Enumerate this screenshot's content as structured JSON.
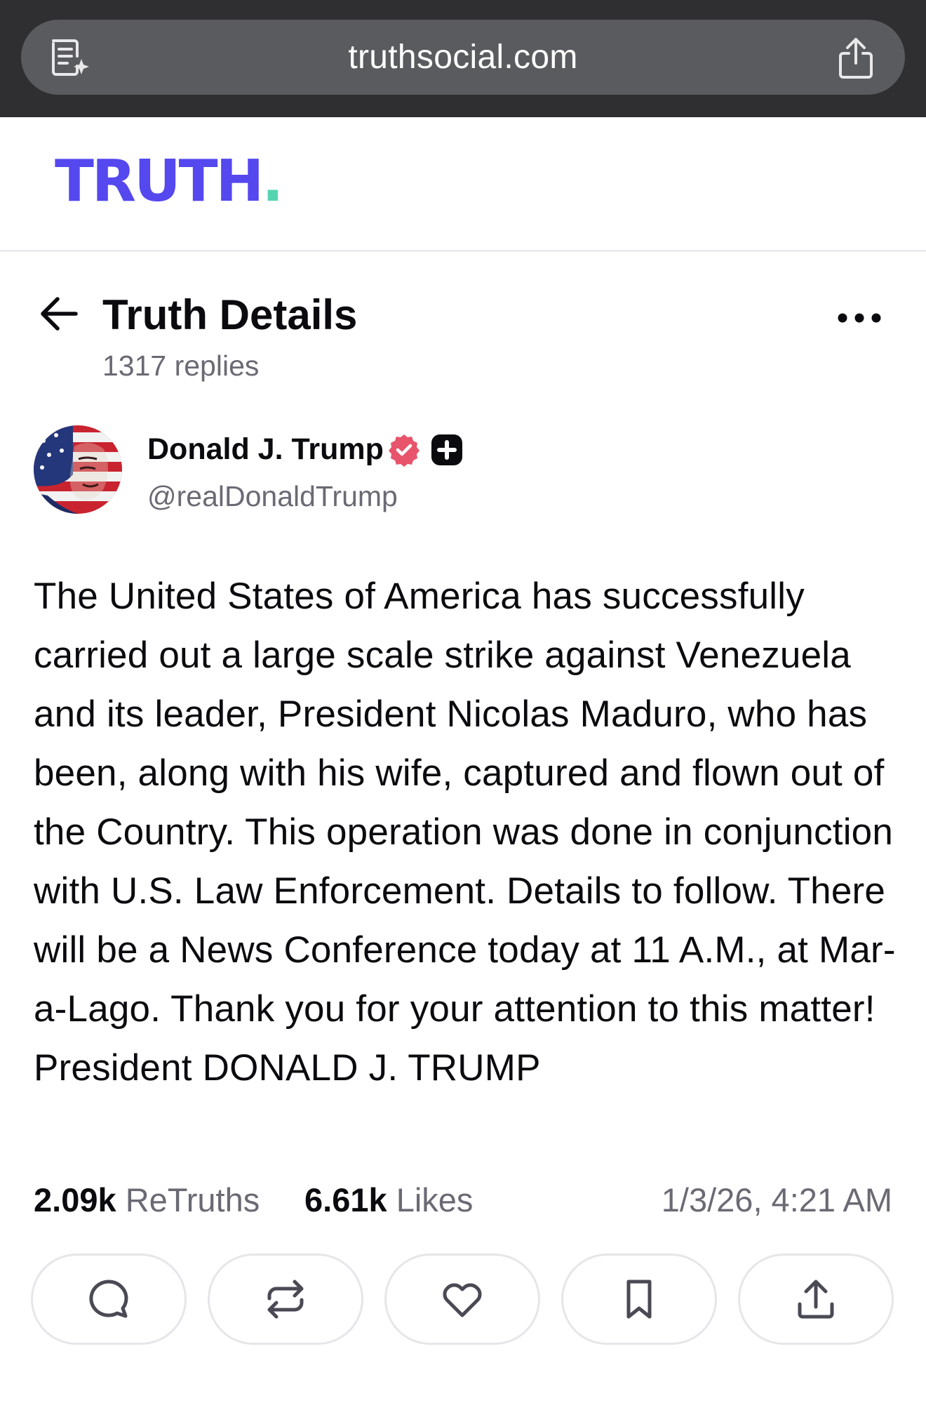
{
  "browser": {
    "url": "truthsocial.com",
    "icons": {
      "left": "reader-mode-icon",
      "right": "share-icon"
    }
  },
  "brand": {
    "logo_text": "TRUTH",
    "logo_dot": ".",
    "colors": {
      "logo": "#5448ee",
      "dot": "#56d4b0"
    }
  },
  "header": {
    "title": "Truth Details",
    "subtitle": "1317 replies",
    "icons": {
      "back": "arrow-left-icon",
      "menu": "more-horizontal-icon"
    }
  },
  "author": {
    "name": "Donald J. Trump",
    "handle": "@realDonaldTrump",
    "badges": [
      "verified-badge-icon",
      "plus-badge-icon"
    ],
    "colors": {
      "verified": "#e8546b"
    }
  },
  "post": {
    "text": "The United States of America has successfully carried out a large scale strike against Venezuela and its leader, President Nicolas Maduro, who has been, along with his wife, captured and flown out of the Country. This operation was done in conjunction with U.S. Law Enforcement. Details to follow. There will be a News Conference today at 11 A.M., at Mar-a-Lago. Thank you for your attention to this matter! President DONALD J. TRUMP"
  },
  "stats": {
    "retruths_count": "2.09k",
    "retruths_label": "ReTruths",
    "likes_count": "6.61k",
    "likes_label": "Likes",
    "timestamp": "1/3/26, 4:21 AM"
  },
  "actions": [
    {
      "icon": "reply-icon"
    },
    {
      "icon": "retruth-icon"
    },
    {
      "icon": "like-icon"
    },
    {
      "icon": "bookmark-icon"
    },
    {
      "icon": "share-icon"
    }
  ]
}
